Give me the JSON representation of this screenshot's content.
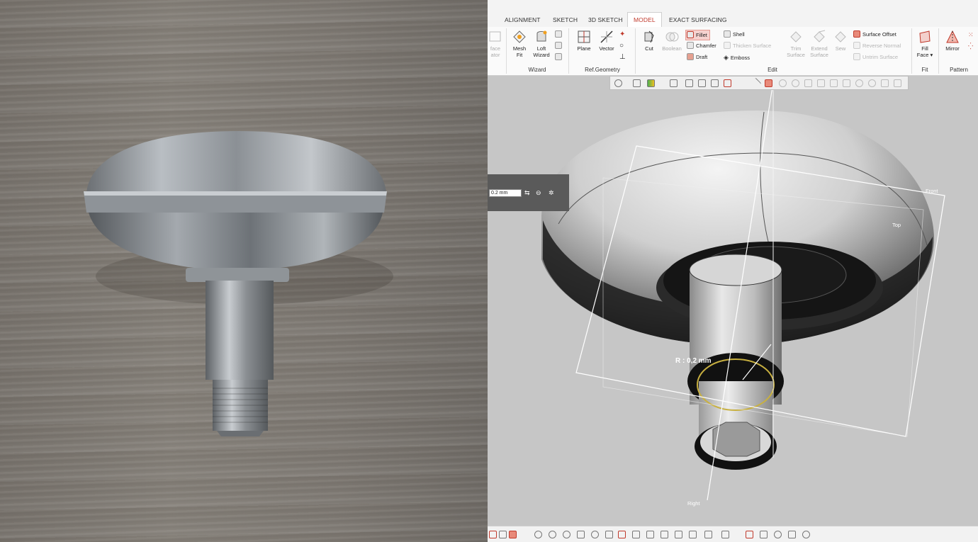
{
  "tabs": [
    {
      "label": "ALIGNMENT",
      "active": false
    },
    {
      "label": "SKETCH",
      "active": false
    },
    {
      "label": "3D SKETCH",
      "active": false
    },
    {
      "label": "MODEL",
      "active": true
    },
    {
      "label": "EXACT SURFACING",
      "active": false
    }
  ],
  "ribbon": {
    "cut_off_label_1": "face",
    "cut_off_label_2": "ator",
    "mesh_fit_1": "Mesh",
    "mesh_fit_2": "Fit",
    "loft_wizard_1": "Loft",
    "loft_wizard_2": "Wizard",
    "plane": "Plane",
    "vector": "Vector",
    "cut": "Cut",
    "booleans": "Boolean",
    "fillet": "Fillet",
    "chamfer": "Chamfer",
    "draft": "Draft",
    "shell": "Shell",
    "thicken_surface": "Thicken Surface",
    "emboss": "Emboss",
    "trim_surface_1": "Trim",
    "trim_surface_2": "Surface",
    "extend_surface_1": "Extend",
    "extend_surface_2": "Surface",
    "sew": "Sew",
    "surface_offset": "Surface Offset",
    "reverse_normal": "Reverse Normal",
    "untrim_surface": "Untrim Surface",
    "fill_face_1": "Fill",
    "fill_face_2": "Face ▾",
    "mirror": "Mirror",
    "groups": {
      "wizard": "Wizard",
      "ref_geometry": "Ref.Geometry",
      "edit": "Edit",
      "fit": "Fit",
      "pattern": "Pattern"
    }
  },
  "viewport": {
    "value_input": "0.2 mm",
    "radius_label": "R :  0,2 mm",
    "axis_front": "Front",
    "axis_top": "Top",
    "axis_right": "Right"
  },
  "colors": {
    "accent": "#c0392b",
    "selection_ring": "#c8b040",
    "viewport_bg": "#c6c6c6"
  }
}
